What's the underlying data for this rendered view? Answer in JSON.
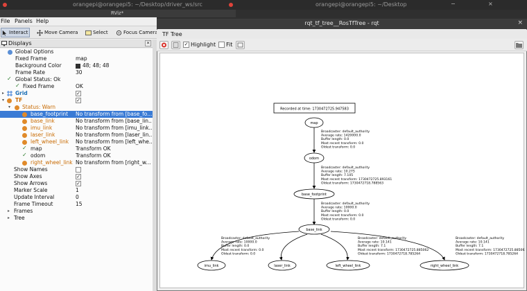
{
  "background_terminals": {
    "left_title": "orangepi@orangepi5: ~/Desktop/driver_ws/src",
    "right_title": "orangepi@orangepi5: ~/Desktop"
  },
  "rviz": {
    "title": "RViz*",
    "menu": [
      "File",
      "Panels",
      "Help"
    ],
    "tools": [
      {
        "label": "Interact",
        "icon": "cursor-icon",
        "active": true
      },
      {
        "label": "Move Camera",
        "icon": "move-icon",
        "active": false
      },
      {
        "label": "Select",
        "icon": "select-icon",
        "active": false
      },
      {
        "label": "Focus Camera",
        "icon": "focus-icon",
        "active": false
      }
    ],
    "displays_title": "Displays",
    "rows": [
      {
        "name": "Global Options",
        "value": ""
      },
      {
        "name": "Fixed Frame",
        "value": "map"
      },
      {
        "name": "Background Color",
        "value": "48; 48; 48"
      },
      {
        "name": "Frame Rate",
        "value": "30"
      },
      {
        "name": "Global Status: Ok",
        "value": ""
      },
      {
        "name": "Fixed Frame",
        "value": "OK"
      },
      {
        "name": "Grid",
        "value": ""
      },
      {
        "name": "TF",
        "value": ""
      },
      {
        "name": "Status: Warn",
        "value": ""
      },
      {
        "name": "base_footprint",
        "value": "No transform from [base_fo..."
      },
      {
        "name": "base_link",
        "value": "No transform from [base_lin..."
      },
      {
        "name": "imu_link",
        "value": "No transform from [imu_link..."
      },
      {
        "name": "laser_link",
        "value": "No transform from [laser_lin..."
      },
      {
        "name": "left_wheel_link",
        "value": "No transform from [left_whe..."
      },
      {
        "name": "map",
        "value": "Transform OK"
      },
      {
        "name": "odom",
        "value": "Transform OK"
      },
      {
        "name": "right_wheel_link",
        "value": "No transform from [right_w..."
      },
      {
        "name": "Show Names",
        "value": ""
      },
      {
        "name": "Show Axes",
        "value": ""
      },
      {
        "name": "Show Arrows",
        "value": ""
      },
      {
        "name": "Marker Scale",
        "value": "1"
      },
      {
        "name": "Update Interval",
        "value": "0"
      },
      {
        "name": "Frame Timeout",
        "value": "15"
      },
      {
        "name": "Frames",
        "value": ""
      },
      {
        "name": "Tree",
        "value": ""
      }
    ],
    "checkboxes": {
      "grid": true,
      "tf": true,
      "show_names": false,
      "show_axes": true,
      "show_arrows": true
    },
    "colors": {
      "selection": "#3a7bd5",
      "warn": "#c86a00",
      "ok": "#2a7a2a",
      "background_swatch": "#303030"
    }
  },
  "rqt": {
    "title": "rqt_tf_tree__RosTfTree - rqt",
    "plugin_title": "TF Tree",
    "highlight_label": "Highlight",
    "highlight_checked": true,
    "fit_label": "Fit",
    "fit_checked": false,
    "graph": {
      "recorded": "Recorded at time: 1730472725.947583",
      "nodes": {
        "map": "map",
        "odom": "odom",
        "base_footprint": "base_footprint",
        "base_link": "base_link",
        "imu_link": "imu_link",
        "laser_link": "laser_link",
        "left_wheel_link": "left_wheel_link",
        "right_wheel_link": "right_wheel_link"
      },
      "edges": {
        "map_odom": [
          "Broadcaster: default_authority",
          "Average rate: 1420000.0",
          "Buffer length: 0.0",
          "Most recent transform: 0.0",
          "Oldest transform: 0.0"
        ],
        "odom_footprint": [
          "Broadcaster: default_authority",
          "Average rate: 10.275",
          "Buffer length: 7.105",
          "Most recent transform: 1730472725.893161",
          "Oldest transform: 1730472718.788563"
        ],
        "footprint_base": [
          "Broadcaster: default_authority",
          "Average rate: 10000.0",
          "Buffer length: 0.0",
          "Most recent transform: 0.0",
          "Oldest transform: 0.0"
        ],
        "base_imu": [
          "Broadcaster: default_authority",
          "Average rate: 10000.0",
          "Buffer length: 0.0",
          "Most recent transform: 0.0",
          "Oldest transform: 0.0"
        ],
        "base_left": [
          "Broadcaster: default_authority",
          "Average rate: 10.141",
          "Buffer length: 7.1",
          "Most recent transform: 1730472725.885062",
          "Oldest transform: 1730472718.785264"
        ],
        "base_right": [
          "Broadcaster: default_authority",
          "Average rate: 10.141",
          "Buffer length: 7.1",
          "Most recent transform: 1730472725.885062",
          "Oldest transform: 1730472718.785264"
        ]
      }
    }
  }
}
